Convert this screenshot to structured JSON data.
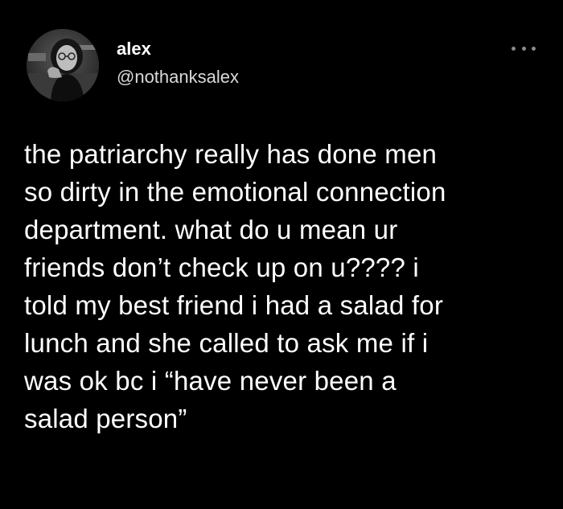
{
  "author": {
    "display_name": "alex",
    "handle": "@nothanksalex",
    "avatar_icon": "profile-photo"
  },
  "menu": {
    "icon": "more-horizontal-icon"
  },
  "tweet": {
    "lines": [
      "the patriarchy really has done men",
      "so dirty in the emotional connection",
      "department. what do u mean ur",
      "friends don’t check up on u???? i",
      "told my best friend i had a salad for",
      "lunch and she called to ask me if i",
      "was ok bc i “have never been a",
      "salad person”"
    ]
  },
  "colors": {
    "background": "#000000",
    "text": "#ffffff",
    "handle": "#d9d9d9",
    "menu_dots": "#8a8a8a"
  }
}
